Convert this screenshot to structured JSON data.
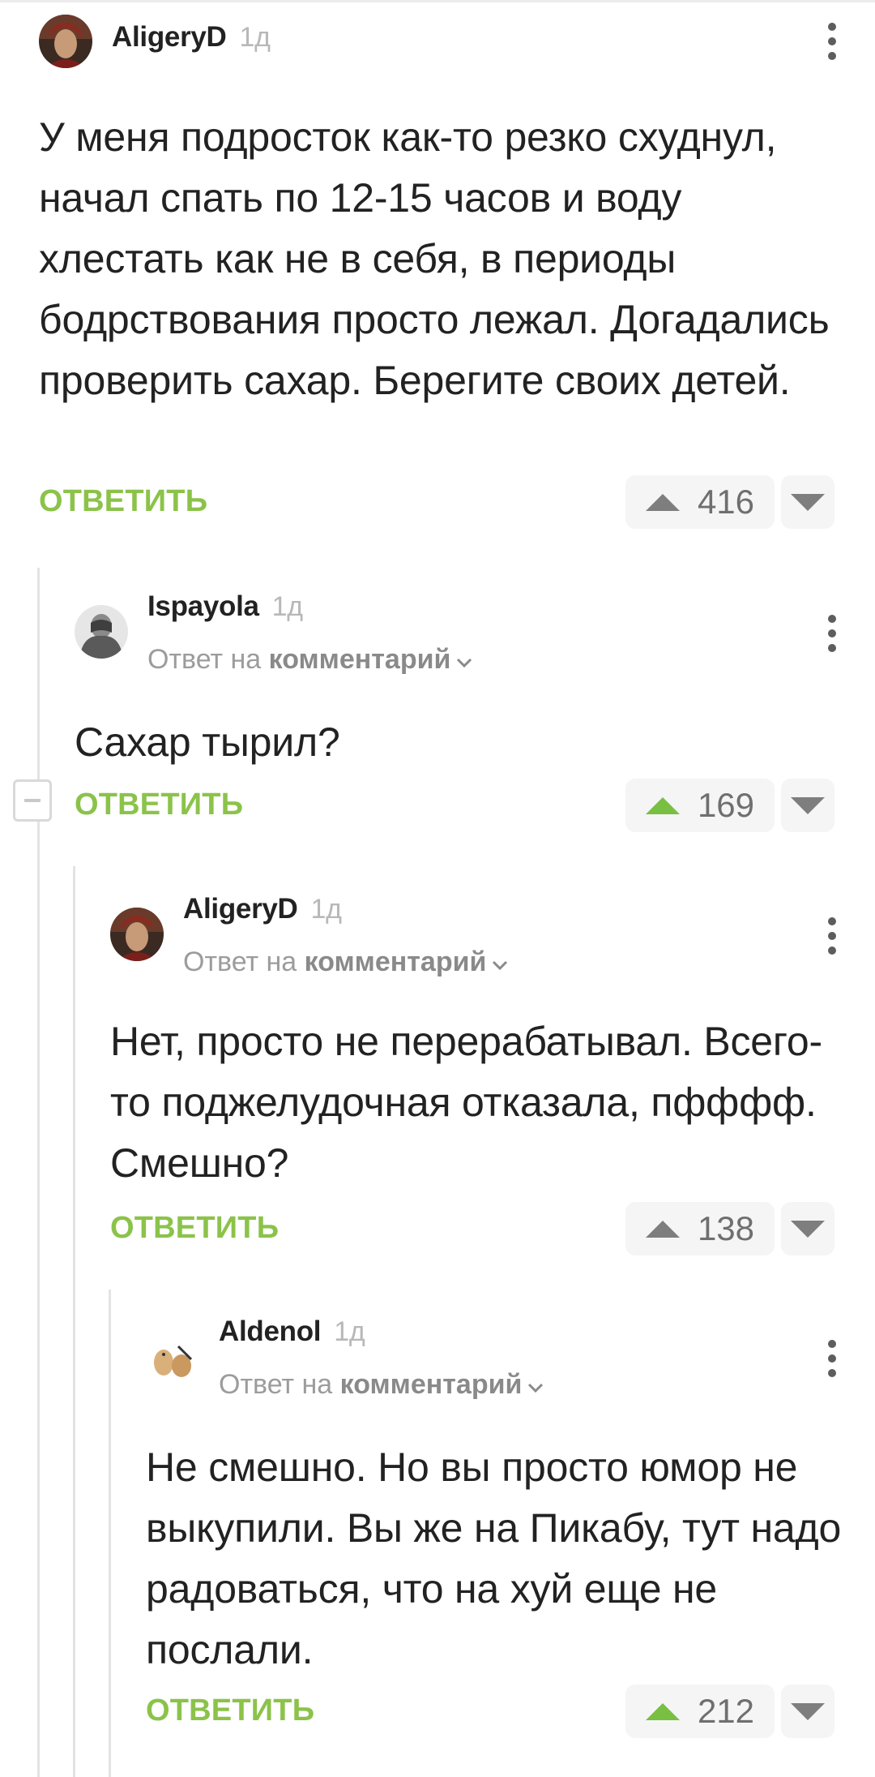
{
  "comments": [
    {
      "author": "AligeryD",
      "time": "1д",
      "reply_to_prefix": "",
      "reply_to_link": "",
      "text": "У меня подросток как-то резко схуднул, начал спать по 12-15 часов и воду хлестать как не в себя, в периоды бодрствования просто лежал. Догадались проверить сахар. Берегите своих детей.",
      "reply_label": "ОТВЕТИТЬ",
      "rating": "416",
      "upvoted": false
    },
    {
      "author": "Ispayola",
      "time": "1д",
      "reply_to_prefix": "Ответ на",
      "reply_to_link": "комментарий",
      "text": "Сахар тырил?",
      "reply_label": "ОТВЕТИТЬ",
      "rating": "169",
      "upvoted": true
    },
    {
      "author": "AligeryD",
      "time": "1д",
      "reply_to_prefix": "Ответ на",
      "reply_to_link": "комментарий",
      "text": "Нет, просто не перерабатывал. Всего-то поджелудочная отказала, пфффф. Смешно?",
      "reply_label": "ОТВЕТИТЬ",
      "rating": "138",
      "upvoted": false
    },
    {
      "author": "Aldenol",
      "time": "1д",
      "reply_to_prefix": "Ответ на",
      "reply_to_link": "комментарий",
      "text": "Не смешно. Но вы просто юмор не выкупили. Вы же на Пикабу, тут надо радоваться, что на хуй еще не послали.",
      "reply_label": "ОТВЕТИТЬ",
      "rating": "212",
      "upvoted": true
    }
  ],
  "colors": {
    "accent_green": "#8bc34a",
    "upvote_active": "#79bf42",
    "thread_line": "#e3e3e3"
  },
  "icons": {
    "menu": "more-vert-icon",
    "upvote": "triangle-up-icon",
    "downvote": "triangle-down-icon",
    "collapse": "minus-box-icon",
    "chevron": "chevron-down-icon"
  }
}
